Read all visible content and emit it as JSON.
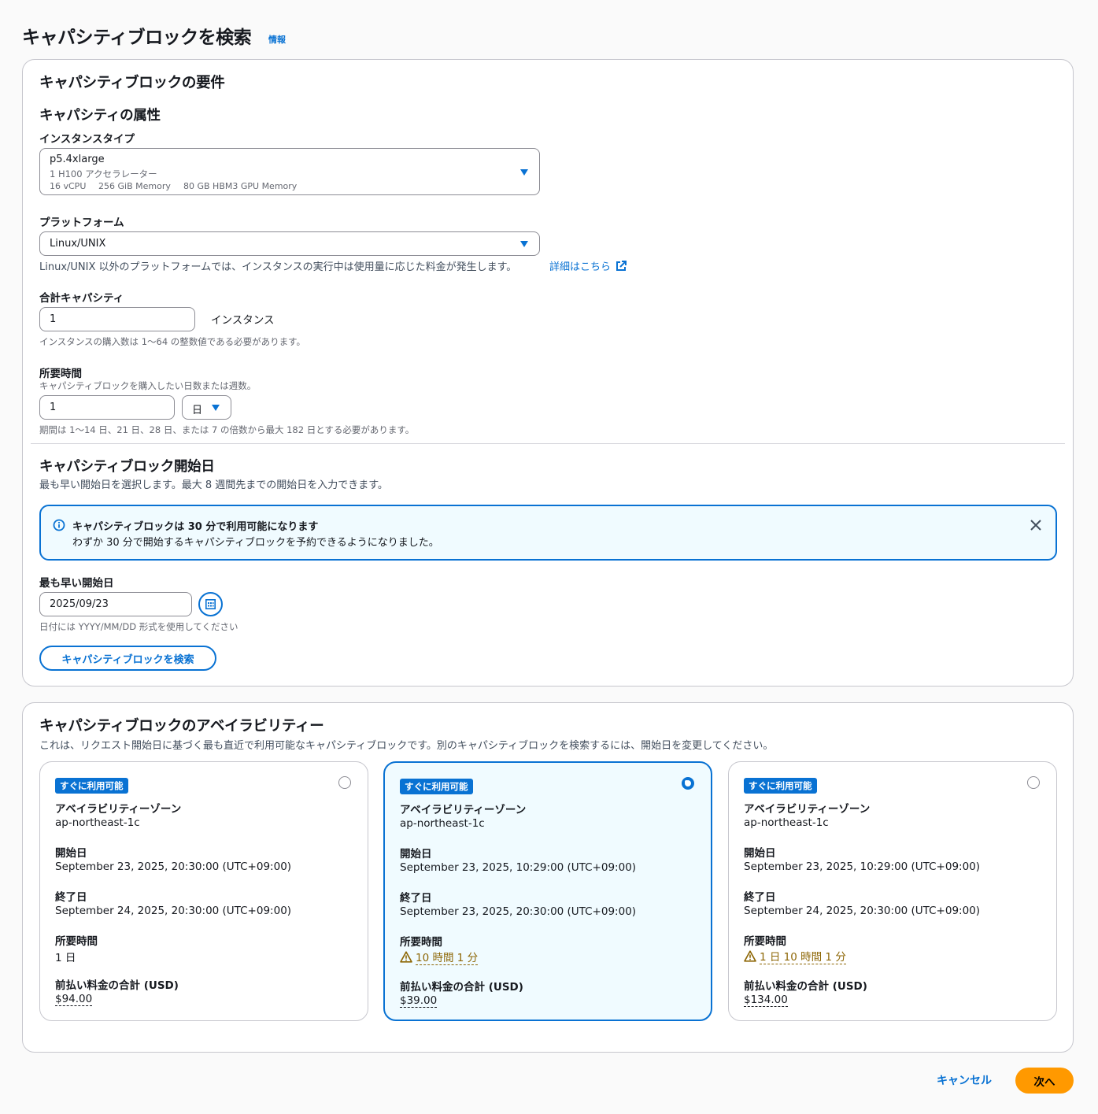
{
  "page": {
    "title": "キャパシティブロックを検索",
    "info": "情報"
  },
  "requirements": {
    "heading": "キャパシティブロックの要件",
    "attributes_heading": "キャパシティの属性",
    "instance_type": {
      "label": "インスタンスタイプ",
      "value": "p5.4xlarge",
      "accelerator": "1 H100 アクセラレーター",
      "vcpu": "16 vCPU",
      "memory": "256 GiB Memory",
      "gpu_memory": "80 GB HBM3 GPU Memory"
    },
    "platform": {
      "label": "プラットフォーム",
      "value": "Linux/UNIX",
      "hint": "Linux/UNIX 以外のプラットフォームでは、インスタンスの実行中は使用量に応じた料金が発生します。",
      "learn_more": "詳細はこちら"
    },
    "total_capacity": {
      "label": "合計キャパシティ",
      "value": "1",
      "unit": "インスタンス",
      "hint": "インスタンスの購入数は 1～64 の整数値である必要があります。"
    },
    "duration": {
      "label": "所要時間",
      "description": "キャパシティブロックを購入したい日数または週数。",
      "value": "1",
      "unit": "日",
      "hint": "期間は 1～14 日、21 日、28 日、または 7 の倍数から最大 182 日とする必要があります。"
    },
    "start": {
      "heading": "キャパシティブロック開始日",
      "description": "最も早い開始日を選択します。最大 8 週間先までの開始日を入力できます。",
      "alert_title": "キャパシティブロックは 30 分で利用可能になります",
      "alert_body": "わずか 30 分で開始するキャパシティブロックを予約できるようになりました。",
      "earliest_label": "最も早い開始日",
      "earliest_value": "2025/09/23",
      "date_hint": "日付には YYYY/MM/DD 形式を使用してください",
      "search_button": "キャパシティブロックを検索"
    }
  },
  "availability": {
    "heading": "キャパシティブロックのアベイラビリティー",
    "description": "これは、リクエスト開始日に基づく最も直近で利用可能なキャパシティブロックです。別のキャパシティブロックを検索するには、開始日を変更してください。",
    "labels": {
      "badge": "すぐに利用可能",
      "az": "アベイラビリティーゾーン",
      "start": "開始日",
      "end": "終了日",
      "duration": "所要時間",
      "price": "前払い料金の合計 (USD)"
    },
    "cards": [
      {
        "az": "ap-northeast-1c",
        "start": "September 23, 2025, 20:30:00 (UTC+09:00)",
        "end": "September 24, 2025, 20:30:00 (UTC+09:00)",
        "duration": "1 日",
        "price": "$94.00",
        "selected": false,
        "warning": false
      },
      {
        "az": "ap-northeast-1c",
        "start": "September 23, 2025, 10:29:00 (UTC+09:00)",
        "end": "September 23, 2025, 20:30:00 (UTC+09:00)",
        "duration": "10 時間 1 分",
        "price": "$39.00",
        "selected": true,
        "warning": true
      },
      {
        "az": "ap-northeast-1c",
        "start": "September 23, 2025, 10:29:00 (UTC+09:00)",
        "end": "September 24, 2025, 20:30:00 (UTC+09:00)",
        "duration": "1 日 10 時間 1 分",
        "price": "$134.00",
        "selected": false,
        "warning": true
      }
    ]
  },
  "footer": {
    "cancel": "キャンセル",
    "next": "次へ"
  },
  "colors": {
    "accent": "#0972d3",
    "primary_button": "#ff9900",
    "warning": "#8d6605",
    "alert_bg": "#f0fbff"
  }
}
